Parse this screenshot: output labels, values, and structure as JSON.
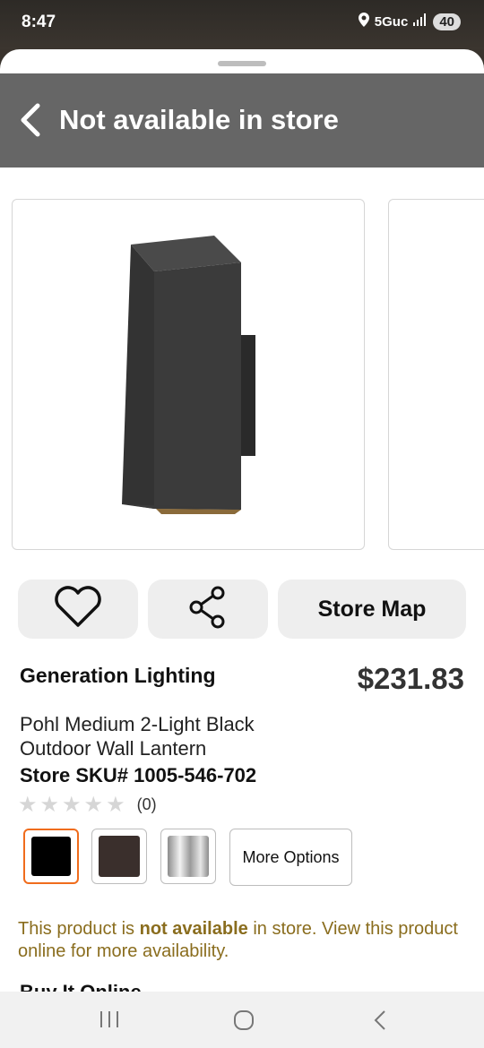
{
  "status": {
    "time": "8:47",
    "network": "5Guc",
    "battery": "40"
  },
  "header": {
    "title": "Not available in store"
  },
  "actions": {
    "store_map": "Store Map"
  },
  "product": {
    "brand": "Generation Lighting",
    "price": "$231.83",
    "title_line1": "Pohl Medium 2-Light Black",
    "title_line2": "Outdoor Wall Lantern",
    "sku": "Store SKU# 1005-546-702",
    "review_count": "(0)",
    "rating_out_of_5": 0
  },
  "swatches": {
    "colors": [
      "#000000",
      "#3a2f2c",
      "silver"
    ],
    "selected_index": 0,
    "more_options": "More Options"
  },
  "availability": {
    "notice_pre": "This product is ",
    "notice_bold": "not available",
    "notice_post": " in store. View this product online for more availability."
  },
  "section": {
    "buy_online": "Buy It Online"
  },
  "icons": [
    "back-chevron-icon",
    "heart-icon",
    "share-icon",
    "recent-apps-icon",
    "home-icon",
    "back-icon"
  ]
}
